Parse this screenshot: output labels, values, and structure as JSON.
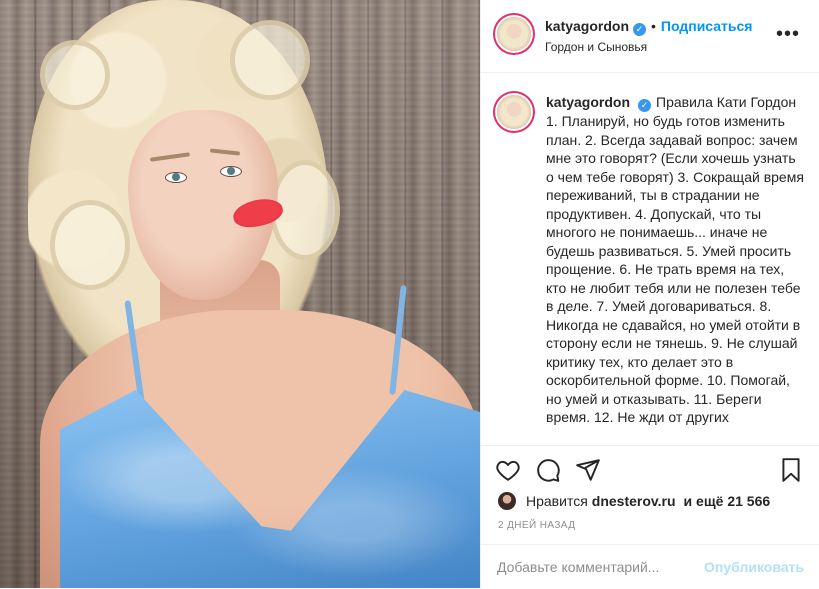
{
  "post": {
    "username": "katyagordon",
    "follow_label": "Подписаться",
    "dot": "•",
    "location": "Гордон и Сыновья",
    "more_label": "•••",
    "caption": "Правила Кати Гордон 1. Планируй, но будь готов изменить план. 2. Всегда задавай вопрос: зачем мне это говорят? (Если хочешь узнать о чем тебе говорят) 3. Сокращай время переживаний, ты в страдании не продуктивен. 4. Допускай, что ты многого не понимаешь... иначе не будешь развиваться. 5. Умей просить прощение. 6. Не трать время на тех, кто не любит тебя или не полезен тебе в деле. 7. Умей договариваться. 8. Никогда не сдавайся, но умей отойти в сторону если не тянешь. 9. Не слушай критику тех, кто делает это в оскорбительной форме. 10. Помогай, но умей и отказывать. 11. Береги время. 12. Не жди от других",
    "likes": {
      "prefix": "Нравится",
      "user": "dnesterov.ru",
      "suffix": "и ещё 21 566"
    },
    "date": "2 ДНЕЙ НАЗАД",
    "comment": {
      "placeholder": "Добавьте комментарий...",
      "value": "",
      "publish_label": "Опубликовать"
    }
  },
  "colors": {
    "accent": "#0095f6",
    "verified": "#3897f0",
    "publish_disabled": "#b2dffc",
    "muted": "#8e8e8e",
    "dress": "#7fb4e3"
  },
  "icons": [
    "verified-badge-icon",
    "more-options-icon",
    "heart-icon",
    "comment-icon",
    "share-icon",
    "bookmark-icon"
  ]
}
